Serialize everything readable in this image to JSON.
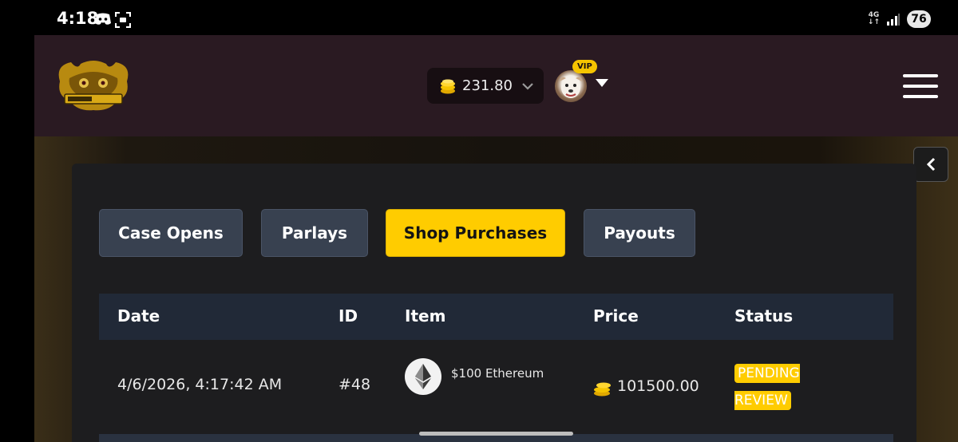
{
  "status_bar": {
    "time": "4:18",
    "network": "4G",
    "battery": "76"
  },
  "header": {
    "balance": "231.80",
    "vip_label": "VIP"
  },
  "tabs": [
    {
      "label": "Case Opens",
      "active": false
    },
    {
      "label": "Parlays",
      "active": false
    },
    {
      "label": "Shop Purchases",
      "active": true
    },
    {
      "label": "Payouts",
      "active": false
    }
  ],
  "table": {
    "columns": [
      "Date",
      "ID",
      "Item",
      "Price",
      "Status"
    ],
    "rows": [
      {
        "date": "4/6/2026, 4:17:42 AM",
        "id": "#48",
        "item": "$100 Ethereum",
        "price": "101500.00",
        "status": "PENDING REVIEW"
      }
    ]
  },
  "colors": {
    "accent": "#ffcc00",
    "header_bg": "#2a1a22",
    "tab_bg": "#384150",
    "table_header_bg": "#212937",
    "panel_bg": "#1d1d1f"
  }
}
